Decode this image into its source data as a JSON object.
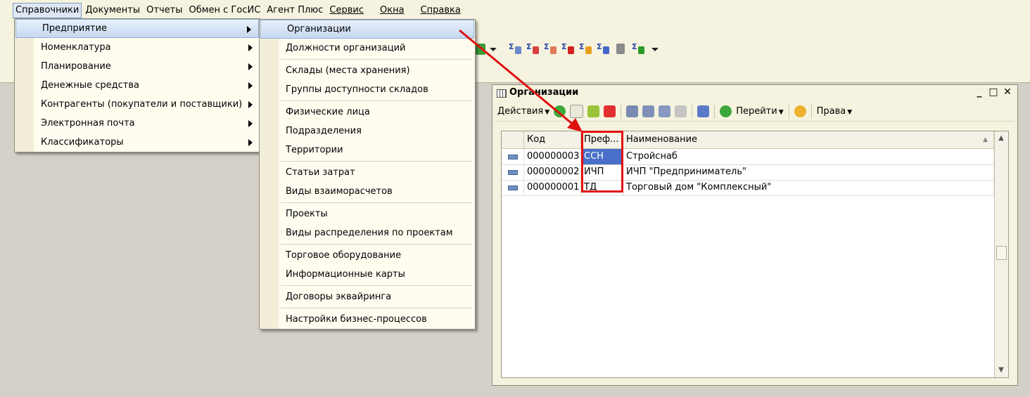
{
  "menubar": {
    "items": [
      "Справочники",
      "Документы",
      "Отчеты",
      "Обмен с ГосИС",
      "Агент Плюс",
      "Сервис",
      "Окна",
      "Справка"
    ],
    "active_item": "Справочники"
  },
  "menu_spravochniki": {
    "items": [
      "Предприятие",
      "Номенклатура",
      "Планирование",
      "Денежные средства",
      "Контрагенты (покупатели и поставщики)",
      "Электронная почта",
      "Классификаторы"
    ],
    "highlighted": "Предприятие"
  },
  "menu_predpriyatie": {
    "groups": [
      [
        "Организации",
        "Должности организаций"
      ],
      [
        "Склады (места хранения)",
        "Группы доступности складов"
      ],
      [
        "Физические лица",
        "Подразделения",
        "Территории"
      ],
      [
        "Статьи затрат",
        "Виды взаиморасчетов"
      ],
      [
        "Проекты",
        "Виды распределения по проектам"
      ],
      [
        "Торговое оборудование",
        "Информационные карты"
      ],
      [
        "Договоры эквайринга"
      ],
      [
        "Настройки бизнес-процессов"
      ]
    ],
    "highlighted": "Организации"
  },
  "toolbar_icons": [
    "sum-person-icon",
    "sum-person-icon",
    "sum-people-icon",
    "sum-red-icon",
    "sum-red-icon",
    "sum-doc-icon",
    "clipboard-icon",
    "sum-check-icon"
  ],
  "window": {
    "title": "Организации",
    "toolbar": {
      "actions_label": "Действия",
      "goto_label": "Перейти",
      "rights_label": "Права"
    },
    "columns": [
      "Код",
      "Преф...",
      "Наименование"
    ],
    "rows": [
      {
        "code": "000000003",
        "prefix": "ССН",
        "name": "Стройснаб"
      },
      {
        "code": "000000002",
        "prefix": "ИЧП",
        "name": "ИЧП \"Предприниматель\""
      },
      {
        "code": "000000001",
        "prefix": "ТД",
        "name": "Торговый дом \"Комплексный\""
      }
    ],
    "selected_cell": "ССН"
  },
  "colors": {
    "annotation_red": "#e01010",
    "selection": "#4a6fc8",
    "panel_bg": "#f5f3df"
  }
}
